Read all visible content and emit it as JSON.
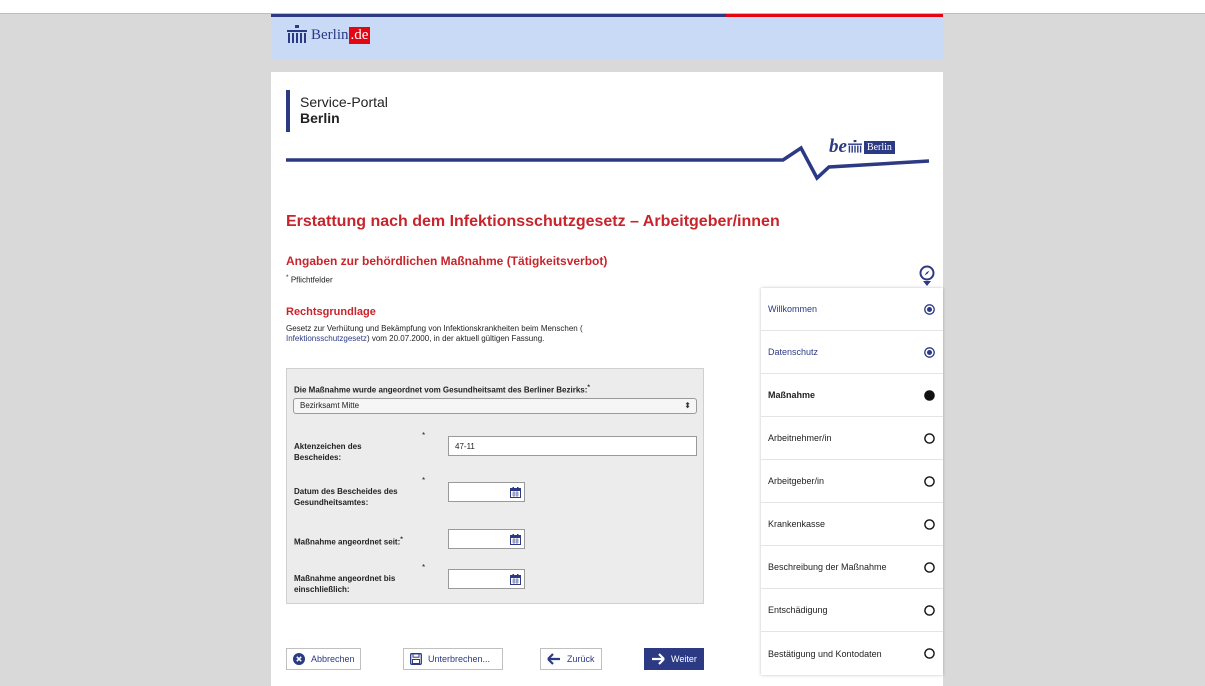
{
  "header": {
    "logo_text": "Berlin",
    "logo_tld": ".de"
  },
  "portal": {
    "line1": "Service-Portal",
    "line2": "Berlin",
    "be_text": "be",
    "be_berlin": "Berlin"
  },
  "form": {
    "title": "Erstattung nach dem Infektionsschutzgesetz – Arbeitgeber/innen",
    "subtitle": "Angaben zur behördlichen Maßnahme (Tätigkeitsverbot)",
    "required_note": "Pflichtfelder",
    "section_title": "Rechtsgrundlage",
    "legal_text_1": "Gesetz zur Verhütung und Bekämpfung von Infektionskrankheiten beim Menschen (",
    "legal_link": "Infektionsschutzgesetz",
    "legal_text_2": ") vom 20.07.2000, in der aktuell gültigen Fassung.",
    "district_label": "Die Maßnahme wurde angeordnet vom Gesundheitsamt des Berliner Bezirks:",
    "district_value": "Bezirksamt Mitte",
    "az_label_1": "Aktenzeichen des",
    "az_label_2": "Bescheides:",
    "az_value": "47-11",
    "date1_label_1": "Datum des Bescheides des",
    "date1_label_2": "Gesundheitsamtes:",
    "date2_label": "Maßnahme angeordnet seit:",
    "date3_label_1": "Maßnahme angeordnet bis",
    "date3_label_2": "einschließlich:",
    "asterisk": "*"
  },
  "buttons": {
    "cancel": "Abbrechen",
    "interrupt": "Unterbrechen...",
    "back": "Zurück",
    "next": "Weiter"
  },
  "steps": [
    {
      "label": "Willkommen",
      "state": "done"
    },
    {
      "label": "Datenschutz",
      "state": "done"
    },
    {
      "label": "Maßnahme",
      "state": "current"
    },
    {
      "label": "Arbeitnehmer/in",
      "state": "open"
    },
    {
      "label": "Arbeitgeber/in",
      "state": "open"
    },
    {
      "label": "Krankenkasse",
      "state": "open"
    },
    {
      "label": "Beschreibung der Maßnahme",
      "state": "open"
    },
    {
      "label": "Entschädigung",
      "state": "open"
    },
    {
      "label": "Bestätigung und Kontodaten",
      "state": "open"
    }
  ],
  "colors": {
    "accent_blue": "#2b3a83",
    "accent_red": "#c8242b",
    "header_bg": "#c9daf7"
  }
}
